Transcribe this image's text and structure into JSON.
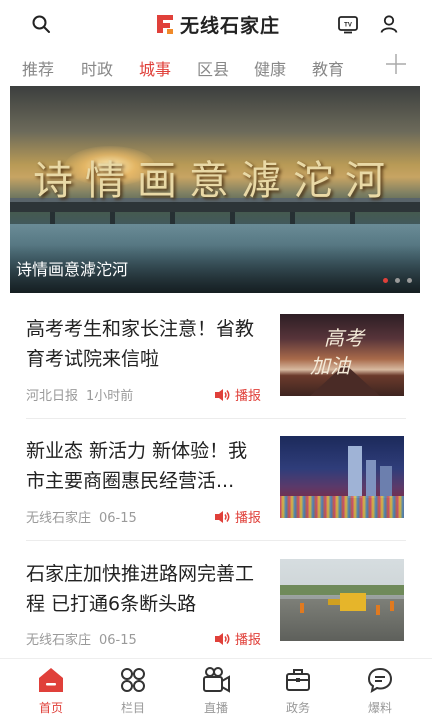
{
  "header": {
    "app_name": "无线石家庄",
    "search_icon": "search-icon",
    "tv_icon": "tv-icon",
    "user_icon": "user-icon",
    "brand_color": "#e0403a"
  },
  "tabs": [
    {
      "label": "推荐",
      "active": false
    },
    {
      "label": "时政",
      "active": false
    },
    {
      "label": "城事",
      "active": true
    },
    {
      "label": "区县",
      "active": false
    },
    {
      "label": "健康",
      "active": false
    },
    {
      "label": "教育",
      "active": false
    }
  ],
  "banner": {
    "image_text": "诗情画意滹沱河",
    "caption": "诗情画意滹沱河",
    "slide_count": 3,
    "active_slide": 1
  },
  "news": [
    {
      "title": "高考考生和家长注意！省教育考试院来信啦",
      "source": "河北日报",
      "time": "1小时前",
      "play_label": "播报",
      "thumb_text_1": "高考",
      "thumb_text_2": "加油"
    },
    {
      "title": "新业态 新活力 新体验！我市主要商圈惠民经营活...",
      "source": "无线石家庄",
      "time": "06-15",
      "play_label": "播报"
    },
    {
      "title": "石家庄加快推进路网完善工程 已打通6条断头路",
      "source": "无线石家庄",
      "time": "06-15",
      "play_label": "播报"
    }
  ],
  "bottom_nav": [
    {
      "label": "首页",
      "icon": "home-icon",
      "active": true
    },
    {
      "label": "栏目",
      "icon": "grid-icon",
      "active": false
    },
    {
      "label": "直播",
      "icon": "camera-icon",
      "active": false
    },
    {
      "label": "政务",
      "icon": "briefcase-icon",
      "active": false
    },
    {
      "label": "爆料",
      "icon": "chat-icon",
      "active": false
    }
  ]
}
